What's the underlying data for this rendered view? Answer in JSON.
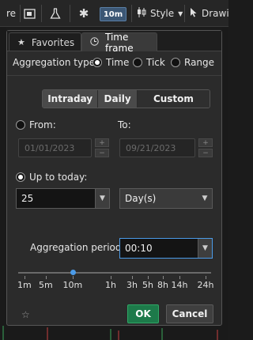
{
  "toolbar": {
    "partial_left_label": "re",
    "timeframe": "10m",
    "style_label": "Style",
    "drawing_label": "Drawi"
  },
  "tabs": [
    {
      "label": "Favorites",
      "icon": "star-icon",
      "active": false
    },
    {
      "label": "Time frame",
      "icon": "clock-icon",
      "active": true
    }
  ],
  "aggregation": {
    "label": "Aggregation type:",
    "options": [
      "Time",
      "Tick",
      "Range"
    ],
    "selected": "Time"
  },
  "mode_tabs": {
    "items": [
      "Intraday",
      "Daily",
      "Custom"
    ],
    "selected": "Custom"
  },
  "range": {
    "from_label": "From:",
    "from_value": "01/01/2023",
    "to_label": "To:",
    "to_value": "09/21/2023",
    "up_to_today_label": "Up to today:",
    "count_value": "25",
    "unit_value": "Day(s)"
  },
  "period": {
    "label": "Aggregation period:",
    "value": "00:10",
    "scale_labels": [
      "1m",
      "5m",
      "10m",
      "1h",
      "3h",
      "5h",
      "8h",
      "14h",
      "24h"
    ],
    "selected_index": 2
  },
  "buttons": {
    "ok": "OK",
    "cancel": "Cancel"
  },
  "colors": {
    "accent": "#4b9be8",
    "ok_green": "#1d7a4a",
    "timeframe_button": "#3c5775"
  }
}
